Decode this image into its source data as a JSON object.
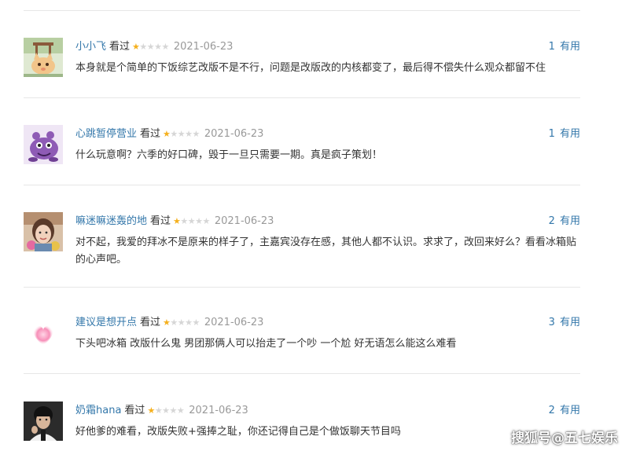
{
  "reviews": [
    {
      "username": "小小飞",
      "status": "看过",
      "rating": 1,
      "rating_max": 5,
      "date": "2021-06-23",
      "useful_count": "1",
      "useful_label": "有用",
      "content": "本身就是个简单的下饭综艺改版不是不行，问题是改版改的内核都变了，最后得不偿失什么观众都留不住",
      "avatar": "cat-avatar"
    },
    {
      "username": "心跳暂停营业",
      "status": "看过",
      "rating": 1,
      "rating_max": 5,
      "date": "2021-06-23",
      "useful_count": "1",
      "useful_label": "有用",
      "content": "什么玩意啊？六季的好口碑，毁于一旦只需要一期。真是疯子策划！",
      "avatar": "purple-monster-avatar"
    },
    {
      "username": "嘛迷嘛迷轰的地",
      "status": "看过",
      "rating": 1,
      "rating_max": 5,
      "date": "2021-06-23",
      "useful_count": "2",
      "useful_label": "有用",
      "content": "对不起，我爱的拜冰不是原来的样子了，主嘉宾没存在感，其他人都不认识。求求了，改回来好么？看看冰箱贴的心声吧。",
      "avatar": "girl-photo-avatar"
    },
    {
      "username": "建议是想开点",
      "status": "看过",
      "rating": 1,
      "rating_max": 5,
      "date": "2021-06-23",
      "useful_count": "3",
      "useful_label": "有用",
      "content": "下头吧冰箱 改版什么鬼 男团那俩人可以抬走了一个吵 一个尬 好无语怎么能这么难看",
      "avatar": "pink-heart-avatar"
    },
    {
      "username": "奶霜hana",
      "status": "看过",
      "rating": 1,
      "rating_max": 5,
      "date": "2021-06-23",
      "useful_count": "2",
      "useful_label": "有用",
      "content": "好他爹的难看，改版失败+强捧之耻，你还记得自己是个做饭聊天节目吗",
      "avatar": "man-photo-avatar"
    }
  ],
  "watermark": "搜狐号@五七娱乐",
  "colors": {
    "link": "#3377aa",
    "star_on": "#f5b01d",
    "star_off": "#d6d6d6",
    "date": "#999999",
    "divider": "#e6e6e6"
  }
}
